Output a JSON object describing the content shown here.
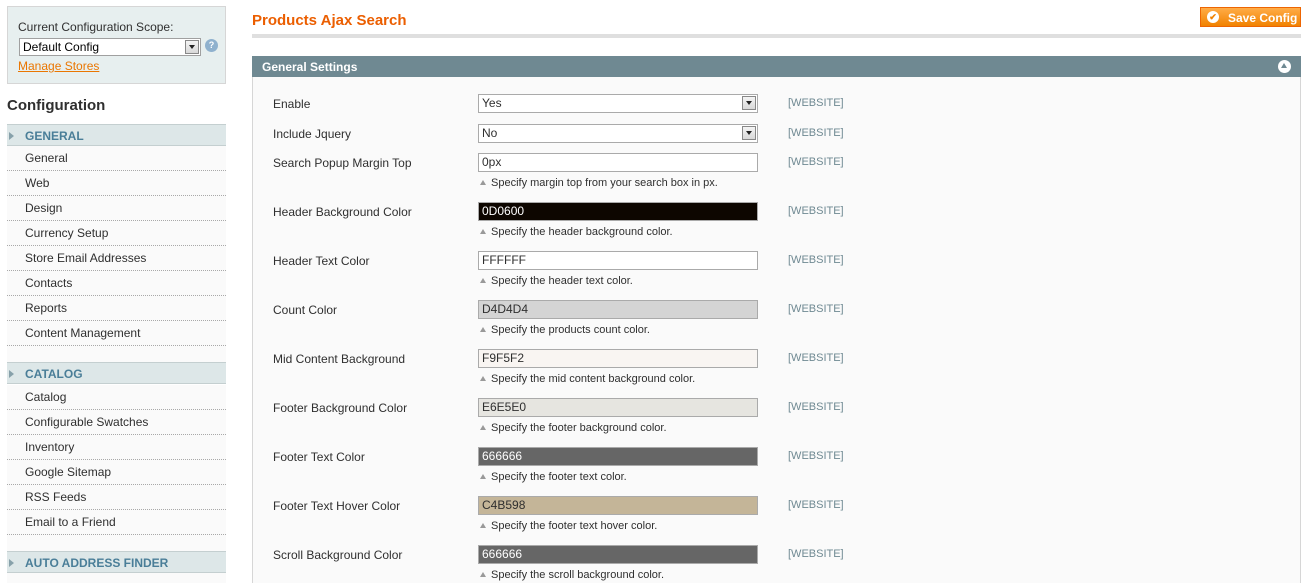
{
  "sidebar": {
    "scope_label": "Current Configuration Scope:",
    "scope_value": "Default Config",
    "manage_stores": "Manage Stores",
    "title": "Configuration",
    "groups": [
      {
        "label": "GENERAL",
        "items": [
          "General",
          "Web",
          "Design",
          "Currency Setup",
          "Store Email Addresses",
          "Contacts",
          "Reports",
          "Content Management"
        ]
      },
      {
        "label": "CATALOG",
        "items": [
          "Catalog",
          "Configurable Swatches",
          "Inventory",
          "Google Sitemap",
          "RSS Feeds",
          "Email to a Friend"
        ]
      },
      {
        "label": "AUTO ADDRESS FINDER",
        "items": []
      }
    ]
  },
  "header": {
    "title": "Products Ajax Search",
    "save_label": "Save Config"
  },
  "section": {
    "title": "General Settings",
    "fields": [
      {
        "label": "Enable",
        "type": "select",
        "value": "Yes",
        "scope": "[WEBSITE]",
        "note": ""
      },
      {
        "label": "Include Jquery",
        "type": "select",
        "value": "No",
        "scope": "[WEBSITE]",
        "note": ""
      },
      {
        "label": "Search Popup Margin Top",
        "type": "text",
        "value": "0px",
        "scope": "[WEBSITE]",
        "note": "Specify margin top from your search box in px."
      },
      {
        "label": "Header Background Color",
        "type": "color",
        "value": "0D0600",
        "bg": "#0D0600",
        "dark": true,
        "scope": "[WEBSITE]",
        "note": "Specify the header background color."
      },
      {
        "label": "Header Text Color",
        "type": "color",
        "value": "FFFFFF",
        "bg": "#FFFFFF",
        "dark": false,
        "scope": "[WEBSITE]",
        "note": "Specify the header text color."
      },
      {
        "label": "Count Color",
        "type": "color",
        "value": "D4D4D4",
        "bg": "#D4D4D4",
        "dark": false,
        "scope": "[WEBSITE]",
        "note": "Specify the products count color."
      },
      {
        "label": "Mid Content Background",
        "type": "color",
        "value": "F9F5F2",
        "bg": "#F9F5F2",
        "dark": false,
        "scope": "[WEBSITE]",
        "note": "Specify the mid content background color."
      },
      {
        "label": "Footer Background Color",
        "type": "color",
        "value": "E6E5E0",
        "bg": "#E6E5E0",
        "dark": false,
        "scope": "[WEBSITE]",
        "note": "Specify the footer background color."
      },
      {
        "label": "Footer Text Color",
        "type": "color",
        "value": "666666",
        "bg": "#666666",
        "dark": true,
        "scope": "[WEBSITE]",
        "note": "Specify the footer text color."
      },
      {
        "label": "Footer Text Hover Color",
        "type": "color",
        "value": "C4B598",
        "bg": "#C4B598",
        "dark": false,
        "scope": "[WEBSITE]",
        "note": "Specify the footer text hover color."
      },
      {
        "label": "Scroll Background Color",
        "type": "color",
        "value": "666666",
        "bg": "#666666",
        "dark": true,
        "scope": "[WEBSITE]",
        "note": "Specify the scroll background color."
      }
    ]
  }
}
